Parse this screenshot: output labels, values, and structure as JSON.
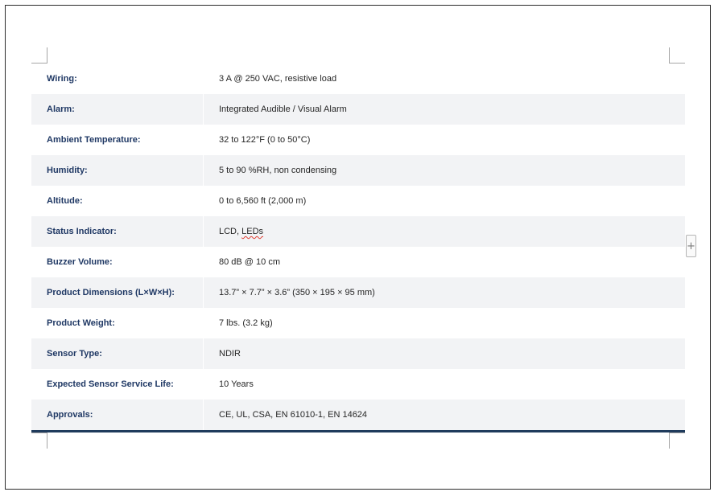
{
  "specs": [
    {
      "label": "Wiring:",
      "value": "3 A @ 250 VAC, resistive load"
    },
    {
      "label": "Alarm:",
      "value": "Integrated Audible / Visual Alarm"
    },
    {
      "label": "Ambient Temperature:",
      "value": "32 to 122°F (0 to 50°C)"
    },
    {
      "label": "Humidity:",
      "value": "5 to 90 %RH, non condensing"
    },
    {
      "label": "Altitude:",
      "value": "0 to 6,560 ft (2,000 m)"
    },
    {
      "label": "Status Indicator:",
      "value_prefix": "LCD, ",
      "value_flagged": "LEDs"
    },
    {
      "label": "Buzzer Volume:",
      "value": "80 dB @ 10 cm"
    },
    {
      "label": "Product Dimensions (L×W×H):",
      "value": "13.7” × 7.7” × 3.6” (350 × 195 × 95 mm)"
    },
    {
      "label": "Product Weight:",
      "value": "7 lbs. (3.2 kg)"
    },
    {
      "label": "Sensor Type:",
      "value": "NDIR"
    },
    {
      "label": "Expected Sensor Service Life:",
      "value": "10 Years"
    },
    {
      "label": "Approvals:",
      "value": "CE, UL, CSA, EN 61010-1, EN 14624"
    }
  ],
  "add_row_glyph": "+",
  "colors": {
    "label_text": "#1f3864",
    "shaded_row": "#f2f3f5",
    "bottom_rule": "#1f3b5c",
    "spellcheck_underline": "#e03c31"
  }
}
